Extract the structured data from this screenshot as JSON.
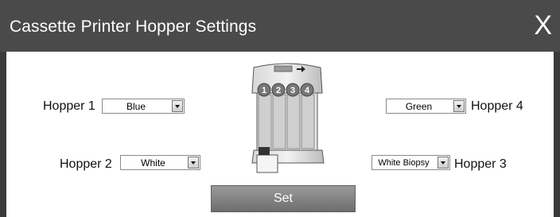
{
  "dialog": {
    "title": "Cassette Printer Hopper Settings",
    "close_label": "X"
  },
  "hoppers": [
    {
      "label": "Hopper 1",
      "selected": "Blue"
    },
    {
      "label": "Hopper 2",
      "selected": "White"
    },
    {
      "label": "Hopper 3",
      "selected": "White Biopsy"
    },
    {
      "label": "Hopper 4",
      "selected": "Green"
    }
  ],
  "printer_image": {
    "slot_numbers": [
      "1",
      "2",
      "3",
      "4"
    ]
  },
  "set_button": {
    "label": "Set"
  },
  "colors": {
    "titlebar": "#4a4a4a",
    "frame": "#3a3a3a",
    "button": "#7e7e7e"
  }
}
